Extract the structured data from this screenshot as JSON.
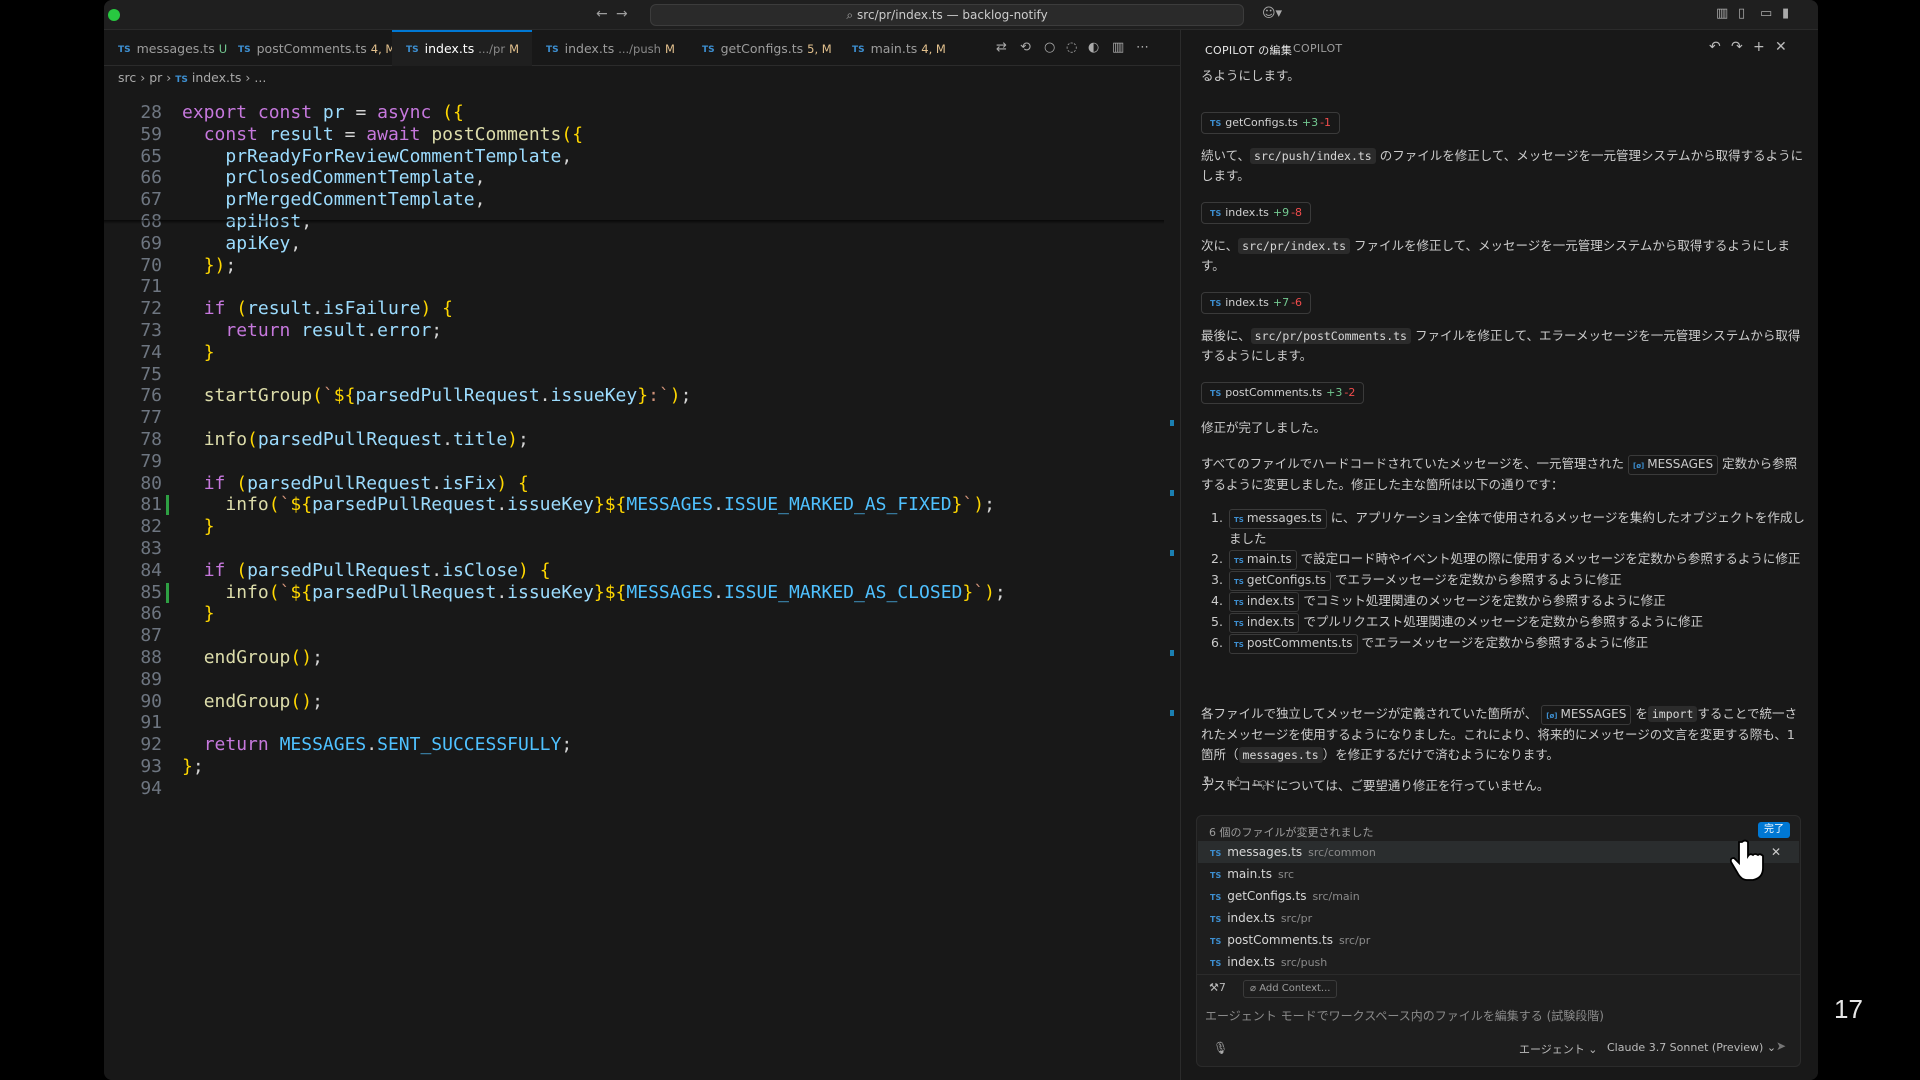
{
  "titlebar": {
    "search_text": "src/pr/index.ts — backlog-notify",
    "back_icon": "←",
    "forward_icon": "→"
  },
  "tabs": [
    {
      "icon": "TS",
      "name": "messages.ts",
      "desc": "",
      "status": "U"
    },
    {
      "icon": "TS",
      "name": "postComments.ts",
      "desc": "",
      "status": "4, M"
    },
    {
      "icon": "TS",
      "name": "index.ts",
      "desc": ".../pr",
      "status": "M"
    },
    {
      "icon": "TS",
      "name": "index.ts",
      "desc": ".../push",
      "status": "M"
    },
    {
      "icon": "TS",
      "name": "getConfigs.ts",
      "desc": "",
      "status": "5, M"
    },
    {
      "icon": "TS",
      "name": "main.ts",
      "desc": "",
      "status": "4, M"
    }
  ],
  "breadcrumb": {
    "parts": [
      "src",
      "pr",
      "index.ts",
      "..."
    ]
  },
  "code": {
    "lines": [
      {
        "n": "28",
        "text": "export const pr = async ({"
      },
      {
        "n": "59",
        "text": "  const result = await postComments({"
      },
      {
        "n": "65",
        "text": "    prReadyForReviewCommentTemplate,"
      },
      {
        "n": "66",
        "text": "    prClosedCommentTemplate,"
      },
      {
        "n": "67",
        "text": "    prMergedCommentTemplate,"
      },
      {
        "n": "68",
        "text": "    apiHost,"
      },
      {
        "n": "69",
        "text": "    apiKey,"
      },
      {
        "n": "70",
        "text": "  });"
      },
      {
        "n": "71",
        "text": ""
      },
      {
        "n": "72",
        "text": "  if (result.isFailure) {"
      },
      {
        "n": "73",
        "text": "    return result.error;"
      },
      {
        "n": "74",
        "text": "  }"
      },
      {
        "n": "75",
        "text": ""
      },
      {
        "n": "76",
        "text": "  startGroup(`${parsedPullRequest.issueKey}:`);"
      },
      {
        "n": "77",
        "text": ""
      },
      {
        "n": "78",
        "text": "  info(parsedPullRequest.title);"
      },
      {
        "n": "79",
        "text": ""
      },
      {
        "n": "80",
        "text": "  if (parsedPullRequest.isFix) {"
      },
      {
        "n": "81",
        "text": "    info(`${parsedPullRequest.issueKey}${MESSAGES.ISSUE_MARKED_AS_FIXED}`);"
      },
      {
        "n": "82",
        "text": "  }"
      },
      {
        "n": "83",
        "text": ""
      },
      {
        "n": "84",
        "text": "  if (parsedPullRequest.isClose) {"
      },
      {
        "n": "85",
        "text": "    info(`${parsedPullRequest.issueKey}${MESSAGES.ISSUE_MARKED_AS_CLOSED}`);"
      },
      {
        "n": "86",
        "text": "  }"
      },
      {
        "n": "87",
        "text": ""
      },
      {
        "n": "88",
        "text": "  endGroup();"
      },
      {
        "n": "89",
        "text": ""
      },
      {
        "n": "90",
        "text": "  endGroup();"
      },
      {
        "n": "91",
        "text": ""
      },
      {
        "n": "92",
        "text": "  return MESSAGES.SENT_SUCCESSFULLY;"
      },
      {
        "n": "93",
        "text": "};"
      },
      {
        "n": "94",
        "text": ""
      }
    ]
  },
  "chat": {
    "tabs": [
      "COPILOT の編集",
      "COPILOT"
    ],
    "top_partial": "るようにします。",
    "chips": [
      {
        "name": "getConfigs.ts",
        "add": "+3",
        "del": "-1"
      },
      {
        "name": "index.ts",
        "add": "+9",
        "del": "-8"
      },
      {
        "name": "index.ts",
        "add": "+7",
        "del": "-6"
      },
      {
        "name": "postComments.ts",
        "add": "+3",
        "del": "-2"
      }
    ],
    "p1_pre": "続いて、",
    "p1_code": "src/push/index.ts",
    "p1_post": " のファイルを修正して、メッセージを一元管理システムから取得するようにします。",
    "p2_pre": "次に、",
    "p2_code": "src/pr/index.ts",
    "p2_post": " ファイルを修正して、メッセージを一元管理システムから取得するようにします。",
    "p3_pre": "最後に、",
    "p3_code": "src/pr/postComments.ts",
    "p3_post": " ファイルを修正して、エラーメッセージを一元管理システムから取得するようにします。",
    "done_text": "修正が完了しました。",
    "summary_pre": "すべてのファイルでハードコードされていたメッセージを、一元管理された",
    "summary_chip": "MESSAGES",
    "summary_post": "定数から参照するように変更しました。修正した主な箇所は以下の通りです：",
    "list": [
      {
        "num": "1.",
        "file": "messages.ts",
        "text": "に、アプリケーション全体で使用されるメッセージを集約したオブジェクトを作成しました"
      },
      {
        "num": "2.",
        "file": "main.ts",
        "text": "で設定ロード時やイベント処理の際に使用するメッセージを定数から参照するように修正"
      },
      {
        "num": "3.",
        "file": "getConfigs.ts",
        "text": "でエラーメッセージを定数から参照するように修正"
      },
      {
        "num": "4.",
        "file": "index.ts",
        "text": "でコミット処理関連のメッセージを定数から参照するように修正"
      },
      {
        "num": "5.",
        "file": "index.ts",
        "text": "でプルリクエスト処理関連のメッセージを定数から参照するように修正"
      },
      {
        "num": "6.",
        "file": "postComments.ts",
        "text": "でエラーメッセージを定数から参照するように修正"
      }
    ],
    "closing_pre": "各ファイルで独立してメッセージが定義されていた箇所が、",
    "closing_chip": "MESSAGES",
    "closing_mid1": "を",
    "closing_code1": "import",
    "closing_mid2": "することで統一されたメッセージを使用するようになりました。これにより、将来的にメッセージの文言を変更する際も、1箇所（",
    "closing_code2": "messages.ts",
    "closing_post": "）を修正するだけで済むようになります。",
    "tests_note": "テストコードについては、ご要望通り修正を行っていません。"
  },
  "changes": {
    "header": "6 個のファイルが変更されました",
    "done_label": "完了",
    "files": [
      {
        "name": "messages.ts",
        "path": "src/common"
      },
      {
        "name": "main.ts",
        "path": "src"
      },
      {
        "name": "getConfigs.ts",
        "path": "src/main"
      },
      {
        "name": "index.ts",
        "path": "src/pr"
      },
      {
        "name": "postComments.ts",
        "path": "src/pr"
      },
      {
        "name": "index.ts",
        "path": "src/push"
      }
    ]
  },
  "input": {
    "tools_count": "7",
    "add_context": "Add Context...",
    "placeholder": "エージェント モードでワークスペース内のファイルを編集する (試験段階)",
    "mode": "エージェント",
    "model": "Claude 3.7 Sonnet (Preview)"
  },
  "slide_number": "17",
  "colors": {
    "accent": "#0078d4",
    "added": "#73c991",
    "deleted": "#f14c4c"
  }
}
